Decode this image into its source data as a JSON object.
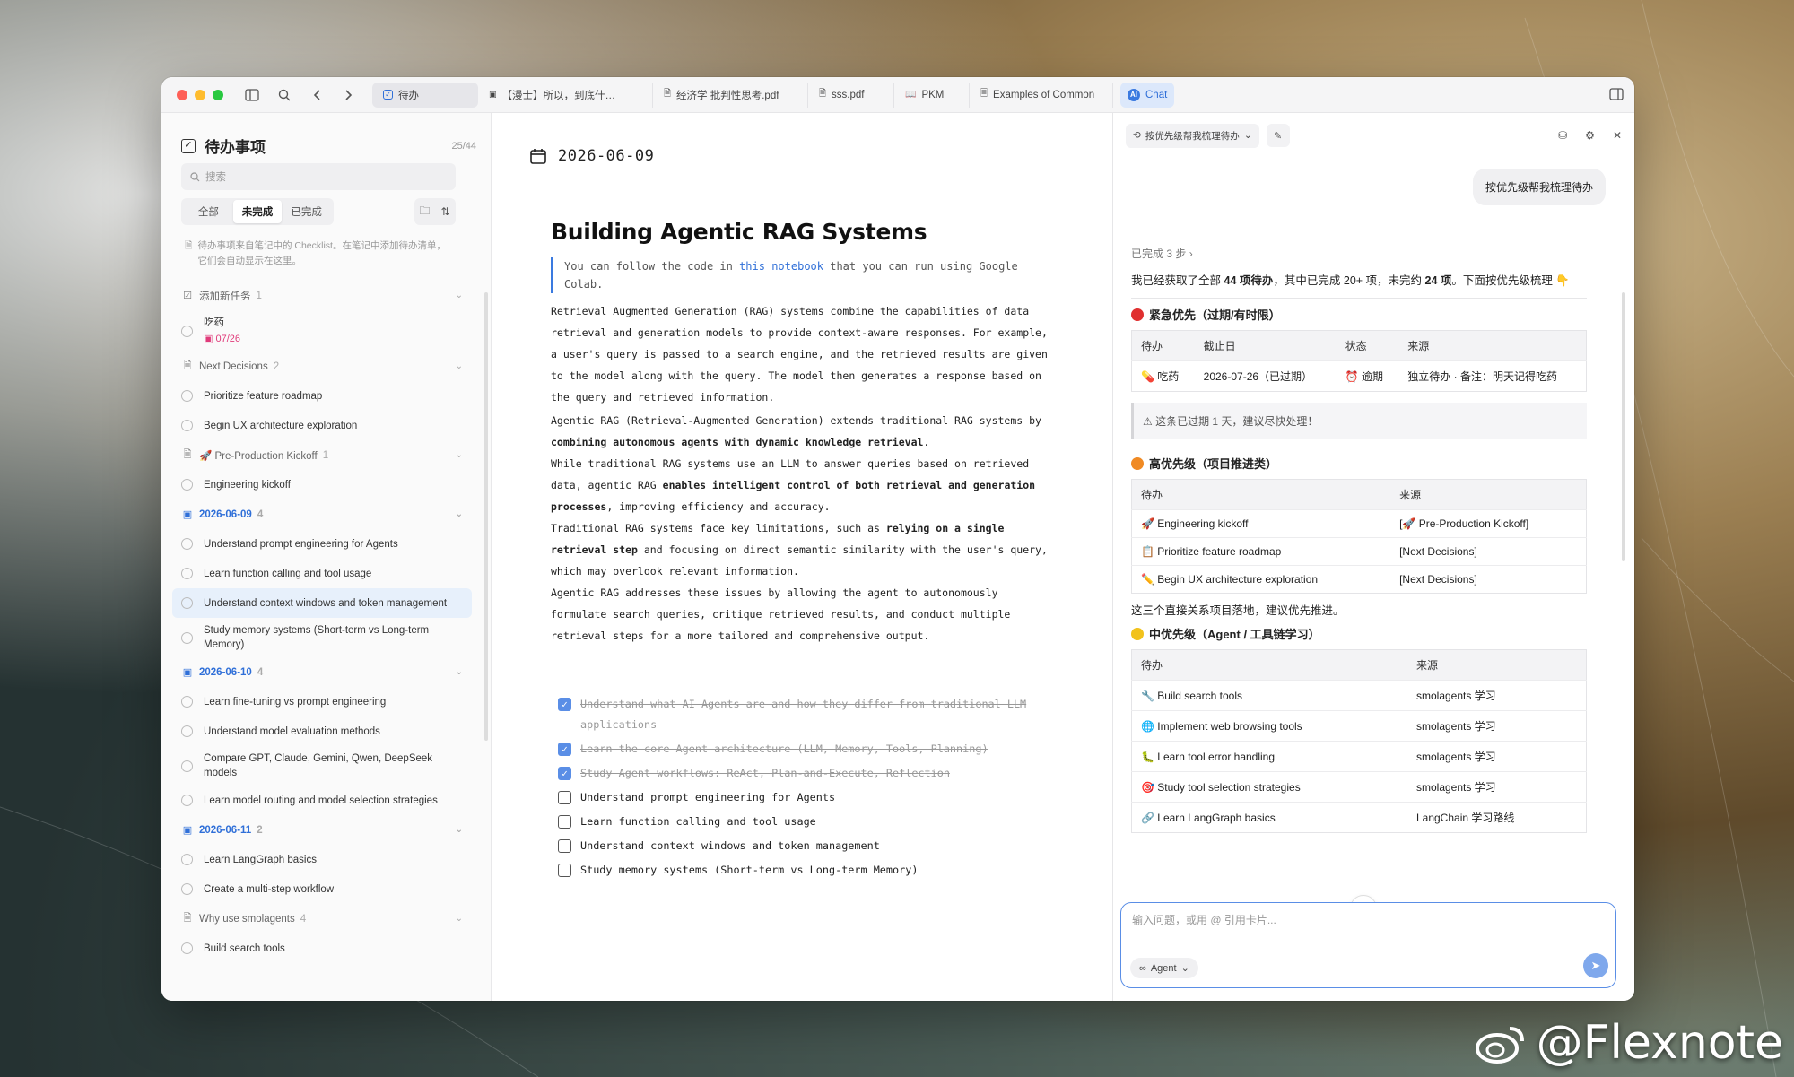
{
  "tabs": [
    {
      "label": "待办",
      "icon": "checkbox-icon"
    },
    {
      "label": "【漫士】所以，到底什…",
      "icon": "video-icon"
    },
    {
      "label": "经济学 批判性思考.pdf",
      "icon": "pdf-icon"
    },
    {
      "label": "sss.pdf",
      "icon": "pdf-icon"
    },
    {
      "label": "PKM",
      "icon": "book-icon"
    },
    {
      "label": "Examples of Common",
      "icon": "doc-icon"
    },
    {
      "label": "Chat",
      "icon": "ai-icon"
    }
  ],
  "sidebar": {
    "title": "待办事项",
    "count": "25/44",
    "search_placeholder": "搜索",
    "filters": [
      "全部",
      "未完成",
      "已完成"
    ],
    "note": "待办事项来自笔记中的 Checklist。在笔记中添加待办清单，它们会自动显示在这里。",
    "groups": [
      {
        "label": "添加新任务",
        "count": "1",
        "type": "normal",
        "items": [
          {
            "text": "吃药",
            "sub": "07/26"
          }
        ]
      },
      {
        "label": "Next Decisions",
        "count": "2",
        "type": "normal",
        "items": [
          {
            "text": "Prioritize feature roadmap"
          },
          {
            "text": "Begin UX architecture exploration"
          }
        ]
      },
      {
        "label": "🚀 Pre-Production Kickoff",
        "count": "1",
        "type": "normal",
        "items": [
          {
            "text": "Engineering kickoff"
          }
        ]
      },
      {
        "label": "2026-06-09",
        "count": "4",
        "type": "date",
        "items": [
          {
            "text": "Understand prompt engineering for Agents"
          },
          {
            "text": "Learn function calling and tool usage"
          },
          {
            "text": "Understand context windows and token management",
            "hl": true
          },
          {
            "text": "Study memory systems (Short-term vs Long-term Memory)"
          }
        ]
      },
      {
        "label": "2026-06-10",
        "count": "4",
        "type": "date",
        "items": [
          {
            "text": "Learn fine-tuning vs prompt engineering"
          },
          {
            "text": "Understand model evaluation methods"
          },
          {
            "text": "Compare GPT, Claude, Gemini, Qwen, DeepSeek models"
          },
          {
            "text": "Learn model routing and model selection strategies"
          }
        ]
      },
      {
        "label": "2026-06-11",
        "count": "2",
        "type": "date",
        "items": [
          {
            "text": "Learn LangGraph basics"
          },
          {
            "text": "Create a multi-step workflow"
          }
        ]
      },
      {
        "label": "Why use smolagents",
        "count": "4",
        "type": "normal",
        "items": [
          {
            "text": "Build search tools"
          }
        ]
      }
    ]
  },
  "main": {
    "date": "2026-06-09",
    "title": "Building Agentic RAG Systems",
    "quote_pre": "You can follow the code in",
    "quote_link": "this notebook",
    "quote_post": "that you can run using Google Colab.",
    "p1": "Retrieval Augmented Generation (RAG) systems combine the capabilities of data retrieval and generation models to provide context-aware responses. For example, a user's query is passed to a search engine, and the retrieved results are given to the model along with the query. The model then generates a response based on the query and retrieved information.",
    "p2_pre": "Agentic RAG (Retrieval-Augmented Generation) extends traditional RAG systems by",
    "p2_bold": "combining autonomous agents with dynamic knowledge retrieval",
    "p3_pre": "While traditional RAG systems use an LLM to answer queries based on retrieved data, agentic RAG",
    "p3_bold": "enables intelligent control of both retrieval and generation processes",
    "p3_post": ", improving efficiency and accuracy.",
    "p4_pre": "Traditional RAG systems face key limitations, such as",
    "p4_bold": "relying on a single retrieval step",
    "p4_post": "and focusing on direct semantic similarity with the user's query, which may overlook relevant information.",
    "p5": "Agentic RAG addresses these issues by allowing the agent to autonomously formulate search queries, critique retrieved results, and conduct multiple retrieval steps for a more tailored and comprehensive output.",
    "tasks": [
      {
        "text": "Understand what AI Agents are and how they differ from traditional LLM applications",
        "done": true
      },
      {
        "text": "Learn the core Agent architecture (LLM, Memory, Tools, Planning)",
        "done": true
      },
      {
        "text": "Study Agent workflows: ReAct, Plan-and-Execute, Reflection",
        "done": true
      },
      {
        "text": "Understand prompt engineering for Agents",
        "done": false
      },
      {
        "text": "Learn function calling and tool usage",
        "done": false
      },
      {
        "text": "Understand context windows and token management",
        "done": false
      },
      {
        "text": "Study memory systems (Short-term vs Long-term Memory)",
        "done": false
      }
    ]
  },
  "chat": {
    "history_label": "按优先级帮我梳理待办",
    "user_msg": "按优先级帮我梳理待办",
    "steps": "已完成 3 步",
    "intro_a": "我已经获取了全部",
    "intro_b": "44 项待办",
    "intro_c": "，其中已完成 20+ 项，未完约",
    "intro_d": "24 项",
    "intro_e": "。下面按优先级梳理 👇",
    "urgent_title": "紧急优先（过期/有时限）",
    "urgent_headers": [
      "待办",
      "截止日",
      "状态",
      "来源"
    ],
    "urgent_rows": [
      [
        "💊 吃药",
        "2026-07-26（已过期）",
        "⏰ 逾期",
        "独立待办 · 备注：明天记得吃药"
      ]
    ],
    "warn": "⚠ 这条已过期 1 天，建议尽快处理！",
    "high_title": "高优先级（项目推进类）",
    "high_headers": [
      "待办",
      "来源"
    ],
    "high_rows": [
      [
        "🚀 Engineering kickoff",
        "[🚀 Pre-Production Kickoff]"
      ],
      [
        "📋 Prioritize feature roadmap",
        "[Next Decisions]"
      ],
      [
        "✏️ Begin UX architecture exploration",
        "[Next Decisions]"
      ]
    ],
    "high_note": "这三个直接关系项目落地，建议优先推进。",
    "mid_title": "中优先级（Agent / 工具链学习）",
    "mid_headers": [
      "待办",
      "来源"
    ],
    "mid_rows": [
      [
        "🔧 Build search tools",
        "smolagents 学习"
      ],
      [
        "🌐 Implement web browsing tools",
        "smolagents 学习"
      ],
      [
        "🐛 Learn tool error handling",
        "smolagents 学习"
      ],
      [
        "🎯 Study tool selection strategies",
        "smolagents 学习"
      ],
      [
        "🔗 Learn LangGraph basics",
        "LangChain 学习路线"
      ]
    ],
    "input_placeholder": "输入问题，或用 @ 引用卡片...",
    "agent_label": "Agent"
  },
  "watermark": "@Flexnote",
  "colors": {
    "accent": "#2f6fd8",
    "urgent": "#e03030",
    "high": "#f08a24",
    "mid": "#f2c21b"
  }
}
